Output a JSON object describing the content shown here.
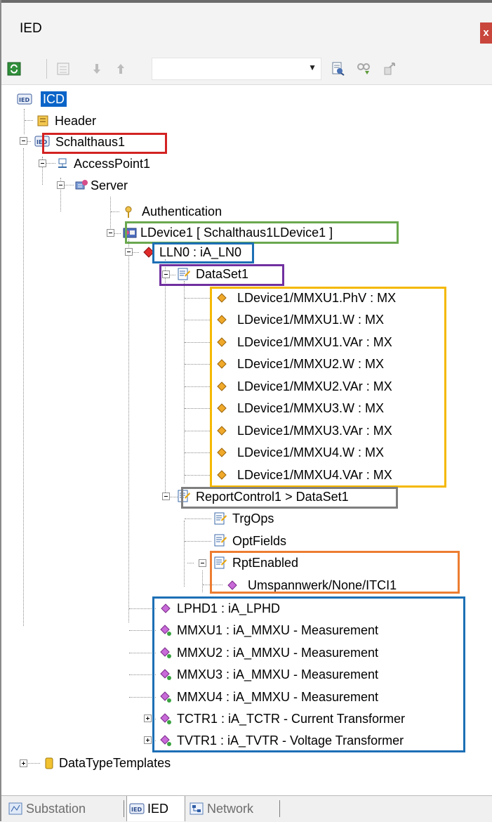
{
  "window": {
    "title": "IED",
    "close_glyph": "x"
  },
  "toolbar": {
    "icons": [
      "refresh-icon",
      "view-icon",
      "move-down-icon",
      "move-up-icon",
      "combo-dropdown",
      "find-icon",
      "replace-icon",
      "export-icon"
    ],
    "combo_value": ""
  },
  "tree": {
    "root": "ICD",
    "header": "Header",
    "ied": "Schalthaus1",
    "access_point": "AccessPoint1",
    "server": "Server",
    "authentication": "Authentication",
    "ldevice": "LDevice1 [ Schalthaus1LDevice1 ]",
    "lln0": "LLN0 : iA_LN0",
    "dataset": "DataSet1",
    "fcdas": [
      "LDevice1/MMXU1.PhV : MX",
      "LDevice1/MMXU1.W : MX",
      "LDevice1/MMXU1.VAr : MX",
      "LDevice1/MMXU2.W : MX",
      "LDevice1/MMXU2.VAr : MX",
      "LDevice1/MMXU3.W : MX",
      "LDevice1/MMXU3.VAr : MX",
      "LDevice1/MMXU4.W : MX",
      "LDevice1/MMXU4.VAr : MX"
    ],
    "report_control": "ReportControl1 > DataSet1",
    "trgops": "TrgOps",
    "optfields": "OptFields",
    "rptenabled": "RptEnabled",
    "client": "Umspannwerk/None/ITCI1",
    "lns": [
      "LPHD1 : iA_LPHD",
      "MMXU1 : iA_MMXU - Measurement",
      "MMXU2 : iA_MMXU - Measurement",
      "MMXU3 : iA_MMXU - Measurement",
      "MMXU4 : iA_MMXU - Measurement",
      "TCTR1 : iA_TCTR - Current Transformer",
      "TVTR1 : iA_TVTR - Voltage Transformer"
    ],
    "datatype_templates": "DataTypeTemplates"
  },
  "tabs": [
    {
      "label": "Substation",
      "icon": "substation-icon",
      "active": false
    },
    {
      "label": "IED",
      "icon": "ied-icon",
      "active": true
    },
    {
      "label": "Network",
      "icon": "network-icon",
      "active": false
    }
  ],
  "colors": {
    "highlight_ied": "#d32222",
    "highlight_ldevice": "#6aa84f",
    "highlight_ln": "#1d6fb5",
    "highlight_dataset": "#7030a0",
    "highlight_fcda": "#f5b800",
    "highlight_report": "#7f7f7f",
    "highlight_rpt": "#ed7d31",
    "selection": "#0a64c8"
  }
}
